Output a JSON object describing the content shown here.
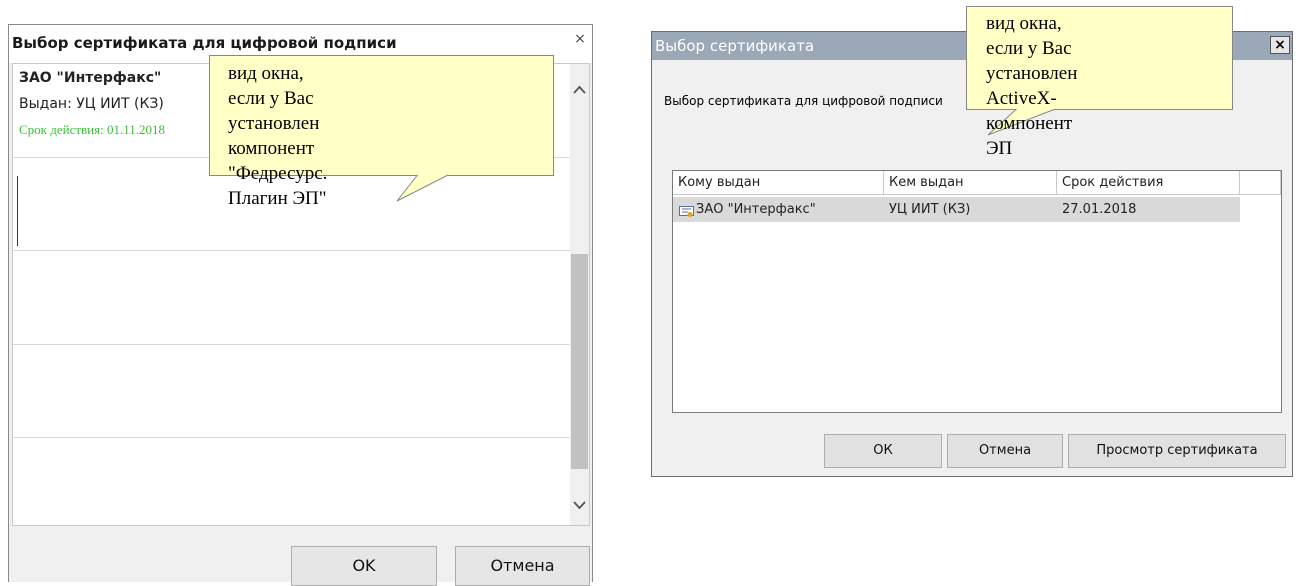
{
  "left_dialog": {
    "title": "Выбор сертификата для цифровой подписи",
    "close_glyph": "×",
    "items": [
      {
        "name": "ЗАО \"Интерфакс\"",
        "issuer": "Выдан: УЦ ИИТ (КЗ)",
        "valid": "Срок действия: 01.11.2018"
      }
    ],
    "scroll_up_glyph": "^",
    "scroll_down_glyph": "v",
    "ok_label": "OK",
    "cancel_label": "Отмена"
  },
  "right_dialog": {
    "title": "Выбор сертификата",
    "close_glyph": "×",
    "description": "Выбор сертификата для цифровой подписи",
    "columns": [
      "Кому выдан",
      "Кем выдан",
      "Срок действия"
    ],
    "rows": [
      {
        "issued_to": "ЗАО \"Интерфакс\"",
        "issued_by": "УЦ ИИТ (КЗ)",
        "expires": "27.01.2018"
      }
    ],
    "ok_label": "ОК",
    "cancel_label": "Отмена",
    "view_label": "Просмотр сертификата"
  },
  "callouts": {
    "left": [
      "вид окна, если у Вас",
      "установлен компонент",
      "\"Федресурс. Плагин ЭП\""
    ],
    "right": [
      "вид окна, если у Вас",
      "установлен ActiveX-",
      "компонент ЭП"
    ],
    "fill": "#ffffc6"
  }
}
